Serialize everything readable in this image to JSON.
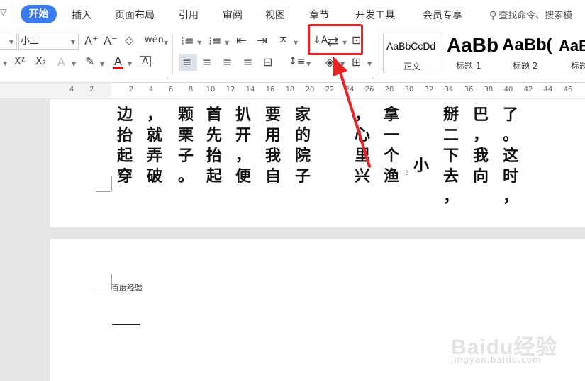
{
  "tabs": {
    "collapse_glyph": "▽",
    "active": "开始",
    "items": [
      "插入",
      "页面布局",
      "引用",
      "审阅",
      "视图",
      "章节",
      "开发工具",
      "会员专享"
    ],
    "search_placeholder": "查找命令、搜索模"
  },
  "ribbon": {
    "font_size": "小二",
    "icons": [
      "font-size-increase-icon",
      "font-size-decrease-icon",
      "clear-format-icon",
      "pinyin-guide-icon",
      "bullet-list-icon",
      "numbered-list-icon",
      "decrease-indent-icon",
      "increase-indent-icon",
      "text-direction-icon",
      "sort-icon",
      "ltr-rtl-direction-icon",
      "chinese-layout-icon",
      "superscript-icon",
      "subscript-icon",
      "text-effect-icon",
      "highlight-icon",
      "font-color-icon",
      "char-border-icon",
      "align-left-icon",
      "align-center-icon",
      "align-right-icon",
      "justify-icon",
      "distributed-icon",
      "line-spacing-icon",
      "shading-icon",
      "border-icon"
    ],
    "glyphs": {
      "font_inc": "A⁺",
      "font_dec": "A⁻",
      "clear": "◇",
      "pinyin": "wén",
      "superscript": "X²",
      "subscript": "X₂",
      "text_effect": "A",
      "font_color": "A",
      "char_border": "A",
      "bullet": "⁝≡",
      "numbered": "⁝≡",
      "indent_dec": "⇤",
      "indent_inc": "⇥",
      "text_dir": "ㅈ",
      "sort": "↓A",
      "ltr_rtl": "⇄",
      "chinese_layout": "⊡",
      "line_spacing": "↕≡",
      "shading": "◈",
      "border": "⊞",
      "align_left": "≡",
      "align_center": "≡",
      "align_right": "≡",
      "justify": "≡",
      "distributed": "⊟"
    }
  },
  "styles": [
    {
      "sample": "AaBbCcDd",
      "name": "正文"
    },
    {
      "sample": "AaBb",
      "name": "标题 1"
    },
    {
      "sample": "AaBb(",
      "name": "标题 2"
    },
    {
      "sample": "AaB",
      "name": "标题"
    }
  ],
  "ruler": {
    "numbers": [
      "4",
      "2",
      "2",
      "4",
      "6",
      "8",
      "10",
      "12",
      "14",
      "16",
      "18",
      "20",
      "22",
      "24",
      "26",
      "28",
      "30",
      "32",
      "34",
      "36",
      "38",
      "40",
      "42",
      "44",
      "46"
    ]
  },
  "document": {
    "columns": [
      "边抬起穿",
      "，就弄破",
      "颗栗子。",
      "首先抬起",
      "扒开，便",
      "要用我自",
      "家的院子",
      "，心里兴",
      "拿一个渔",
      "小",
      "掰二下去，",
      "巴，我向",
      "了。这时，"
    ],
    "page_number": "5",
    "header_text": "百度经验"
  },
  "watermark": {
    "logo": "Baidu经验",
    "url": "jingyan.baidu.com"
  },
  "colors": {
    "accent": "#3a7bf0",
    "highlight": "#e82424"
  }
}
